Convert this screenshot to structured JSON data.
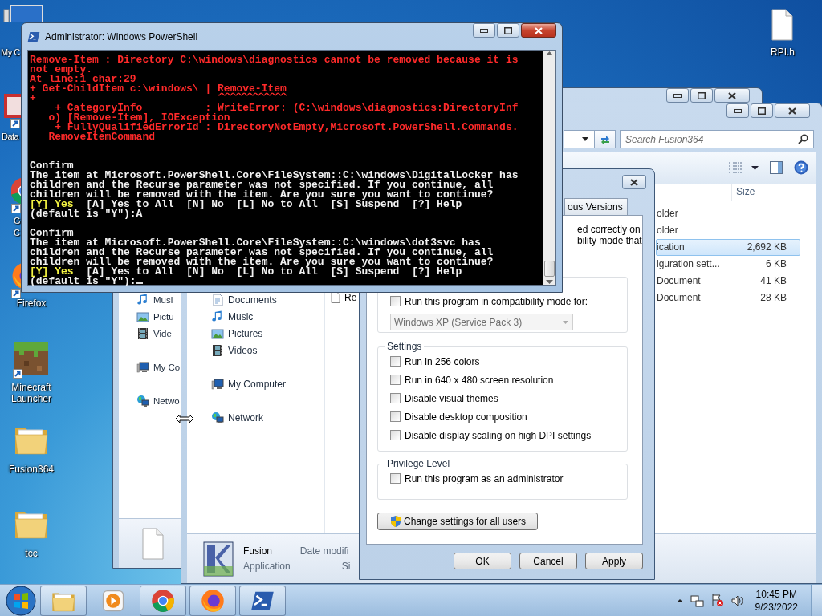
{
  "desktop_icons": [
    {
      "kind": "computer",
      "label_lines": [
        "My C"
      ]
    },
    {
      "kind": "shortcut",
      "label_lines": [
        "Data"
      ]
    },
    {
      "kind": "chrome-shortcut",
      "label_lines": [
        "G",
        "C"
      ]
    },
    {
      "kind": "firefox-shortcut",
      "label_lines": [
        "Firefox"
      ]
    },
    {
      "kind": "minecraft",
      "label_lines": [
        "Minecraft",
        "Launcher"
      ]
    },
    {
      "kind": "folder",
      "label_lines": [
        "Fusion364"
      ]
    },
    {
      "kind": "folder",
      "label_lines": [
        "tcc"
      ]
    },
    {
      "kind": "file",
      "label_lines": [
        "RPI.h"
      ]
    }
  ],
  "explorer_back": {
    "nav_groups": [
      {
        "items": [
          {
            "kind": "music",
            "label": "Musi"
          },
          {
            "kind": "pictures",
            "label": "Pictu"
          },
          {
            "kind": "videos",
            "label": "Vide"
          }
        ]
      },
      {
        "items": [
          {
            "kind": "computer",
            "label": "My Co"
          }
        ]
      },
      {
        "items": [
          {
            "kind": "network",
            "label": "Netwo"
          }
        ]
      }
    ],
    "details": {
      "kind": "file"
    }
  },
  "explorer_front": {
    "search": {
      "placeholder": "Search Fusion364"
    },
    "nav_groups": [
      {
        "items": [
          {
            "kind": "documents",
            "label": "Documents"
          },
          {
            "kind": "music",
            "label": "Music"
          },
          {
            "kind": "pictures",
            "label": "Pictures"
          },
          {
            "kind": "videos",
            "label": "Videos"
          }
        ]
      },
      {
        "items": [
          {
            "kind": "computer",
            "label": "My Computer"
          }
        ]
      },
      {
        "items": [
          {
            "kind": "network",
            "label": "Network"
          }
        ]
      }
    ],
    "size_header": "Size",
    "files": [
      {
        "type": "older",
        "selected": false
      },
      {
        "type": "older",
        "selected": false
      },
      {
        "type": "ication",
        "size": "2,692 KB",
        "selected": true
      },
      {
        "type": "iguration sett...",
        "size": "6 KB",
        "selected": false
      },
      {
        "type": "Document",
        "size": "41 KB",
        "selected": false
      },
      {
        "name": "Re",
        "type": "Document",
        "size": "28 KB",
        "selected": false
      }
    ],
    "details": {
      "kind": "application",
      "name": "Fusion",
      "type": "Application",
      "date_label": "Date modifi",
      "size_label": "Si"
    }
  },
  "dialog": {
    "tabs": [
      {
        "label": "ous Versions",
        "selected": false
      }
    ],
    "description_lines": [
      "ed correctly on",
      "bility mode that"
    ],
    "compat_checkbox": {
      "label": "Run this program in compatibility mode for:",
      "checked": false
    },
    "compat_select": {
      "value": "Windows XP (Service Pack 3)",
      "disabled": true
    },
    "settings_title": "Settings",
    "settings": [
      {
        "label": "Run in 256 colors",
        "checked": false
      },
      {
        "label": "Run in 640 x 480 screen resolution",
        "checked": false
      },
      {
        "label": "Disable visual themes",
        "checked": false
      },
      {
        "label": "Disable desktop composition",
        "checked": false
      },
      {
        "label": "Disable display scaling on high DPI settings",
        "checked": false
      }
    ],
    "privilege_title": "Privilege Level",
    "privilege": [
      {
        "label": "Run this program as an administrator",
        "checked": false
      }
    ],
    "change_button": "Change settings for all users",
    "buttons": [
      "OK",
      "Cancel",
      "Apply"
    ]
  },
  "powershell": {
    "title": "Administrator: Windows PowerShell",
    "blocks": [
      {
        "kind": "error",
        "lines": [
          [
            {
              "kind": "error",
              "text": "Remove-Item : Directory C:\\windows\\diagnostics cannot be removed because it is"
            }
          ],
          [
            {
              "kind": "error",
              "text": "not empty."
            }
          ],
          [
            {
              "kind": "error",
              "text": "At line:1 char:29"
            }
          ],
          [
            {
              "kind": "error",
              "text": "+ Get-ChildItem c:\\windows\\ | "
            },
            {
              "kind": "squiggle",
              "text": "Remove-Item"
            }
          ],
          [
            {
              "kind": "error",
              "text": "+"
            }
          ],
          [
            {
              "kind": "error",
              "text": "    + CategoryInfo          : WriteError: (C:\\windows\\diagnostics:DirectoryInf"
            }
          ],
          [
            {
              "kind": "error",
              "text": "   o) [Remove-Item], IOException"
            }
          ],
          [
            {
              "kind": "error",
              "text": "    + FullyQualifiedErrorId : DirectoryNotEmpty,Microsoft.PowerShell.Commands."
            }
          ],
          [
            {
              "kind": "error",
              "text": "   RemoveItemCommand"
            }
          ]
        ]
      },
      {
        "kind": "confirm",
        "lines": [
          [
            {
              "kind": "text",
              "text": "Confirm"
            }
          ],
          [
            {
              "kind": "text",
              "text": "The item at Microsoft.PowerShell.Core\\FileSystem::C:\\windows\\DigitalLocker has"
            }
          ],
          [
            {
              "kind": "text",
              "text": "children and the Recurse parameter was not specified. If you continue, all"
            }
          ],
          [
            {
              "kind": "text",
              "text": "children will be removed with the item. Are you sure you want to continue?"
            }
          ],
          [
            {
              "kind": "default",
              "text": "[Y] Yes"
            },
            {
              "kind": "text",
              "text": "  [A] Yes to All  [N] No  [L] No to All  [S] Suspend  [?] Help"
            }
          ],
          [
            {
              "kind": "text",
              "text": "(default is \"Y\"):A"
            }
          ]
        ]
      },
      {
        "kind": "confirm",
        "lines": [
          [
            {
              "kind": "text",
              "text": "Confirm"
            }
          ],
          [
            {
              "kind": "text",
              "text": "The item at Microsoft.PowerShell.Core\\FileSystem::C:\\windows\\dot3svc has"
            }
          ],
          [
            {
              "kind": "text",
              "text": "children and the Recurse parameter was not specified. If you continue, all"
            }
          ],
          [
            {
              "kind": "text",
              "text": "children will be removed with the item. Are you sure you want to continue?"
            }
          ],
          [
            {
              "kind": "default",
              "text": "[Y] Yes"
            },
            {
              "kind": "text",
              "text": "  [A] Yes to All  [N] No  [L] No to All  [S] Suspend  [?] Help"
            }
          ],
          [
            {
              "kind": "text",
              "text": "(default is \"Y\"):"
            }
          ]
        ]
      }
    ],
    "cursor": true
  },
  "taskbar": {
    "buttons": [
      {
        "kind": "explorer",
        "running": true
      },
      {
        "kind": "media-player",
        "running": false
      },
      {
        "kind": "chrome",
        "running": true
      },
      {
        "kind": "firefox",
        "running": true
      },
      {
        "kind": "powershell",
        "running": true
      }
    ],
    "tray_icons": [
      {
        "kind": "show-hidden"
      },
      {
        "kind": "network"
      },
      {
        "kind": "action-center"
      },
      {
        "kind": "volume"
      }
    ],
    "time": "10:45 PM",
    "date": "9/23/2022"
  }
}
